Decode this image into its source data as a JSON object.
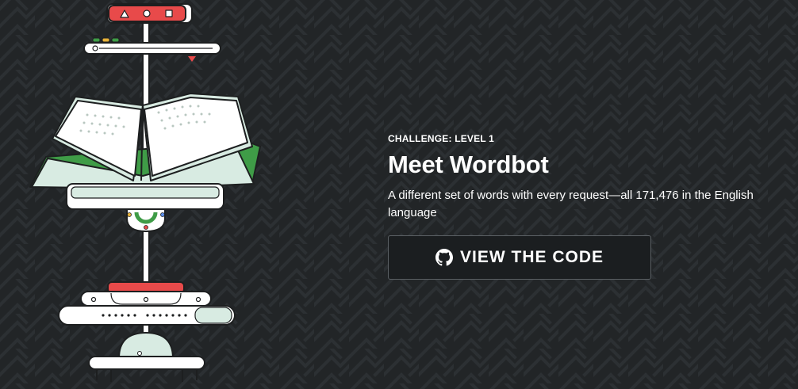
{
  "hero": {
    "eyebrow": "CHALLENGE: LEVEL 1",
    "title": "Meet Wordbot",
    "description": "A different set of words with every request—all 171,476 in the English language",
    "cta_label": "VIEW THE CODE"
  },
  "icons": {
    "cta_icon": "github-icon",
    "illustration": "wordbot-robot-with-book"
  },
  "colors": {
    "background": "#222527",
    "accent_red": "#e84a4a",
    "accent_green": "#3f9c47",
    "book_mint": "#d8ebe2",
    "button_bg": "#1b1e20"
  }
}
